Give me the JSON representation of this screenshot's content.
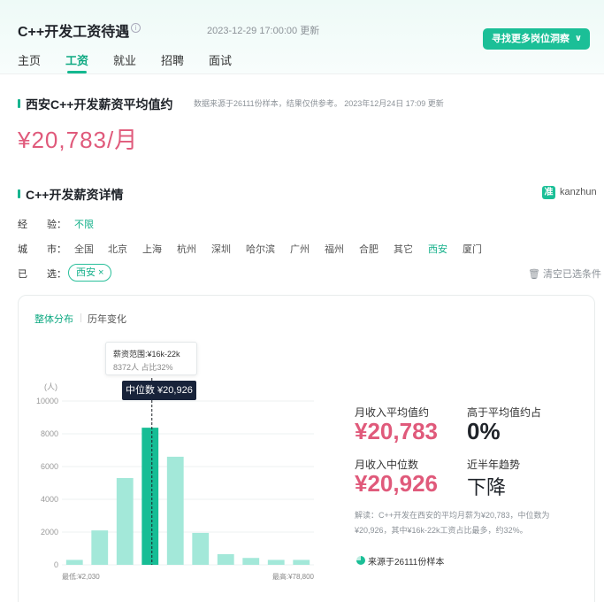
{
  "header": {
    "title": "C++开发工资待遇",
    "info_icon": "i",
    "update_time": "2023-12-29 17:00:00 更新",
    "cta": "寻找更多岗位洞察",
    "cta_chevron": "∨",
    "tabs": [
      "主页",
      "工资",
      "就业",
      "招聘",
      "面试"
    ],
    "active_tab": "工资"
  },
  "section_avg": {
    "title": "西安C++开发薪资平均值约",
    "note": "数据来源于26111份样本，结果仅供参考。 2023年12月24日 17:09 更新",
    "value": "¥20,783/月"
  },
  "section_detail": {
    "title": "C++开发薪资详情",
    "brand_logo": "准",
    "brand": "kanzhun"
  },
  "filters": {
    "experience_label": "经　　验：",
    "experience_value": "不限",
    "city_label": "城　　市：",
    "cities": [
      "全国",
      "北京",
      "上海",
      "杭州",
      "深圳",
      "哈尔滨",
      "广州",
      "福州",
      "合肥",
      "其它",
      "西安",
      "厦门"
    ],
    "selected_city": "西安",
    "selected_label": "已　　选：",
    "chip": "西安 ×",
    "clear": "🗑 清空已选条件"
  },
  "chart_tabs": [
    "整体分布",
    "历年变化"
  ],
  "tooltip": {
    "line1": "薪资范围:¥16k-22k",
    "line2": "8372人  占比32%"
  },
  "median_label": "中位数 ¥20,926",
  "chart_data": {
    "type": "bar",
    "y_unit": "(人)",
    "yticks": [
      0,
      2000,
      4000,
      6000,
      8000,
      10000
    ],
    "ylim": [
      0,
      10000
    ],
    "values": [
      300,
      2100,
      5300,
      8372,
      6600,
      1950,
      650,
      420,
      300,
      300
    ],
    "highlight_index": 3,
    "median_position": 20926,
    "x_min_label": "最低:¥2,030",
    "x_max_label": "最高:¥78,800",
    "bar_color": "#a3e8d9",
    "highlight_color": "#17bd95"
  },
  "stats": {
    "avg_label": "月收入平均值约",
    "avg_value": "¥20,783",
    "above_label": "高于平均值约占",
    "above_value": "0%",
    "median_label": "月收入中位数",
    "median_value": "¥20,926",
    "trend_label": "近半年趋势",
    "trend_value": "下降"
  },
  "note": "解读：C++开发在西安的平均月薪为¥20,783，中位数为¥20,926，其中¥16k-22k工资占比最多，约32%。",
  "source": "来源于26111份样本",
  "colors": {
    "accent": "#1bbf97",
    "pink": "#e05a7b"
  }
}
